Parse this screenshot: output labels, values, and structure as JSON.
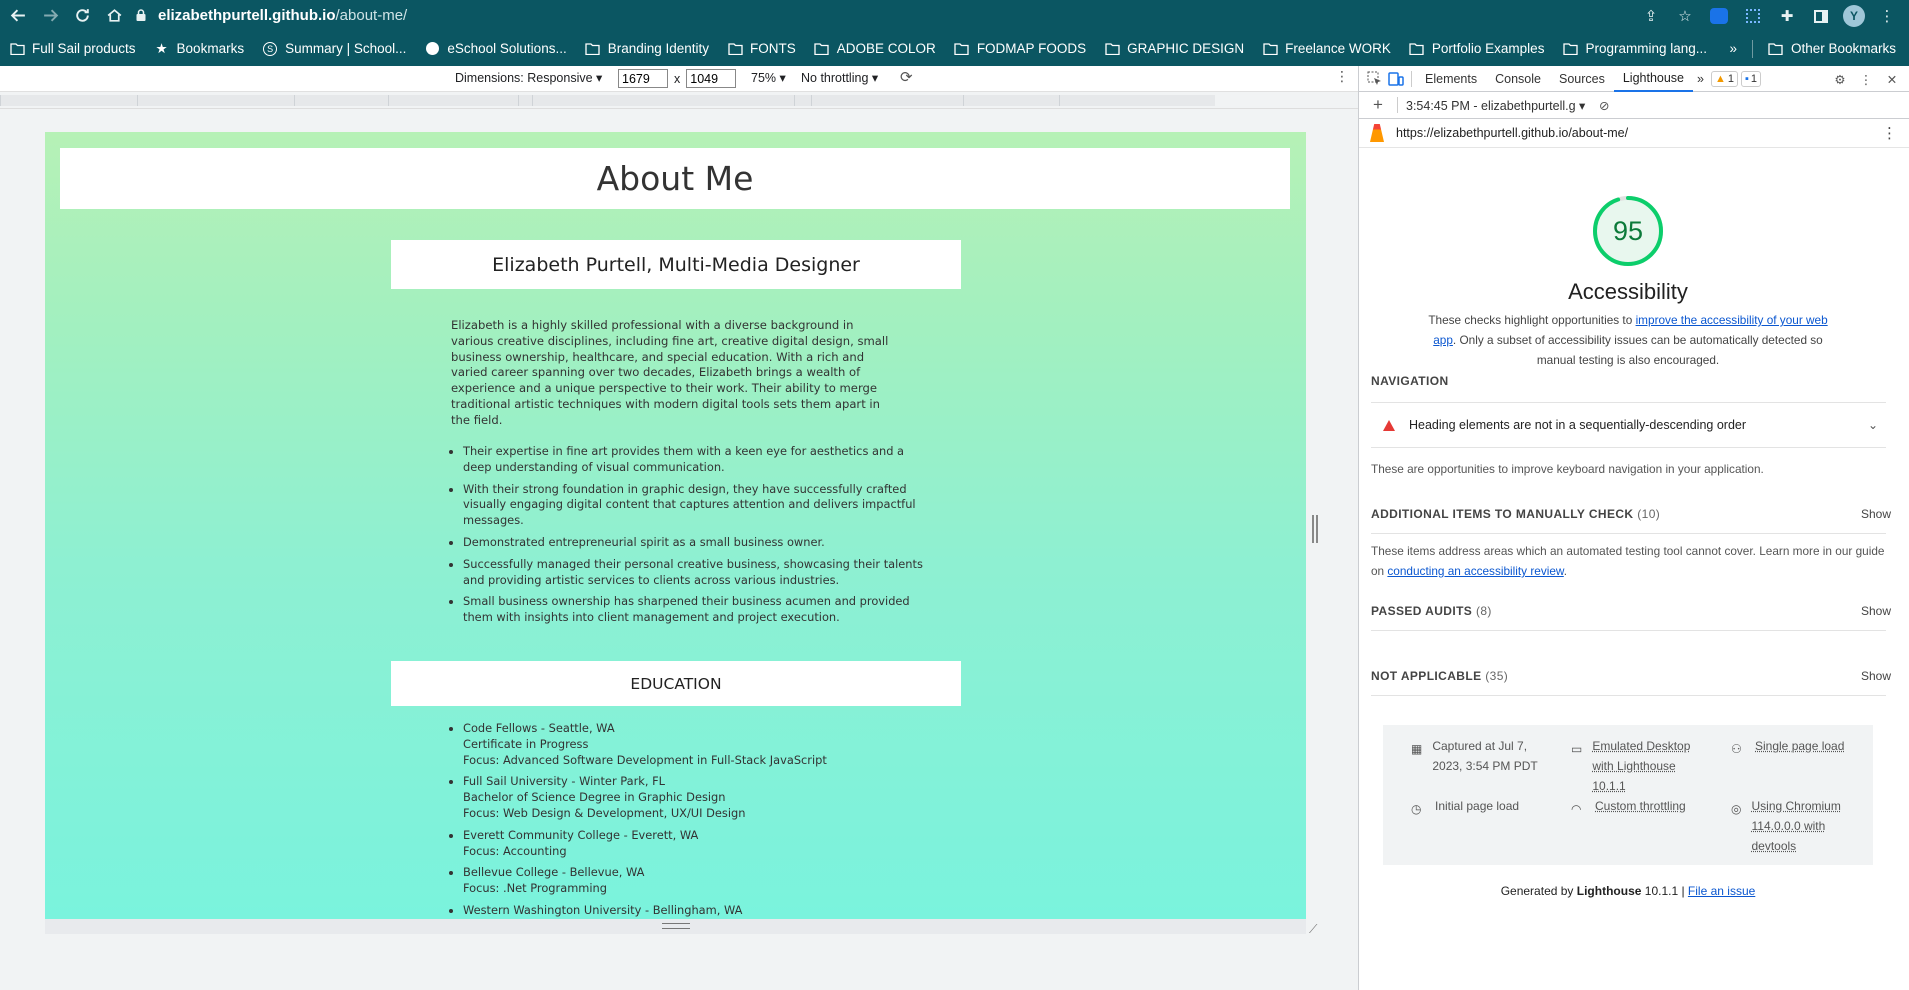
{
  "browser": {
    "url_host": "elizabethpurtell.github.io",
    "url_path": "/about-me/",
    "bookmarks": [
      {
        "label": "Full Sail products",
        "icon": "folder-icon"
      },
      {
        "label": "Bookmarks",
        "icon": "star-icon"
      },
      {
        "label": "Summary | School...",
        "icon": "s-logo-icon"
      },
      {
        "label": "eSchool Solutions...",
        "icon": "globe-icon"
      },
      {
        "label": "Branding Identity",
        "icon": "folder-icon"
      },
      {
        "label": "FONTS",
        "icon": "folder-icon"
      },
      {
        "label": "ADOBE COLOR",
        "icon": "folder-icon"
      },
      {
        "label": "FODMAP FOODS",
        "icon": "folder-icon"
      },
      {
        "label": "GRAPHIC DESIGN",
        "icon": "folder-icon"
      },
      {
        "label": "Freelance WORK",
        "icon": "folder-icon"
      },
      {
        "label": "Portfolio Examples",
        "icon": "folder-icon"
      },
      {
        "label": "Programming lang...",
        "icon": "folder-icon"
      }
    ],
    "overflow": "»",
    "other_bookmarks": "Other Bookmarks"
  },
  "device_toolbar": {
    "dimensions_label": "Dimensions: Responsive ▾",
    "width": "1679",
    "times": "x",
    "height": "1049",
    "zoom": "75% ▾",
    "throttling": "No throttling ▾"
  },
  "page": {
    "title": "About Me",
    "subtitle": "Elizabeth Purtell, Multi-Media Designer",
    "intro": "Elizabeth is a highly skilled professional with a diverse background in various creative disciplines, including fine art, creative digital design, small business ownership, healthcare, and special education. With a rich and varied career spanning over two decades, Elizabeth brings a wealth of experience and a unique perspective to their work. Their ability to merge traditional artistic techniques with modern digital tools sets them apart in the field.",
    "skills": [
      "Their expertise in fine art provides them with a keen eye for aesthetics and a deep understanding of visual communication.",
      "With their strong foundation in graphic design, they have successfully crafted visually engaging digital content that captures attention and delivers impactful messages.",
      "Demonstrated entrepreneurial spirit as a small business owner.",
      "Successfully managed their personal creative business, showcasing their talents and providing artistic services to clients across various industries.",
      "Small business ownership has sharpened their business acumen and provided them with insights into client management and project execution."
    ],
    "education_heading": "EDUCATION",
    "education": [
      {
        "lines": [
          "Code Fellows - Seattle, WA",
          "Certificate in Progress",
          "Focus: Advanced Software Development in Full-Stack JavaScript"
        ]
      },
      {
        "lines": [
          "Full Sail University - Winter Park, FL",
          "Bachelor of Science Degree in Graphic Design",
          "Focus: Web Design & Development, UX/UI Design"
        ]
      },
      {
        "lines": [
          "Everett Community College - Everett, WA",
          "Focus: Accounting"
        ]
      },
      {
        "lines": [
          "Bellevue College - Bellevue, WA",
          "Focus: .Net Programming"
        ]
      },
      {
        "lines": [
          "Western Washington University - Bellingham, WA"
        ]
      }
    ]
  },
  "devtools": {
    "tabs": [
      "Elements",
      "Console",
      "Sources",
      "Lighthouse"
    ],
    "more_tabs": "»",
    "warn_count": "1",
    "info_count": "1",
    "report_selector": "3:54:45 PM - elizabethpurtell.g ▾",
    "report_url": "https://elizabethpurtell.github.io/about-me/",
    "score": "95",
    "score_fraction": 0.95,
    "score_color": "#0cce6b",
    "category": "Accessibility",
    "desc_before": "These checks highlight opportunities to ",
    "desc_link": "improve the accessibility of your web app",
    "desc_after": ". Only a subset of accessibility issues can be automatically detected so manual testing is also encouraged.",
    "nav_group": "NAVIGATION",
    "nav_audit": "Heading elements are not in a sequentially-descending order",
    "nav_desc": "These are opportunities to improve keyboard navigation in your application.",
    "manual_group": "ADDITIONAL ITEMS TO MANUALLY CHECK",
    "manual_count": "(10)",
    "manual_desc_before": "These items address areas which an automated testing tool cannot cover. Learn more in our guide on ",
    "manual_desc_link": "conducting an accessibility review",
    "manual_desc_after": ".",
    "passed_group": "PASSED AUDITS",
    "passed_count": "(8)",
    "na_group": "NOT APPLICABLE",
    "na_count": "(35)",
    "show_label": "Show",
    "meta": {
      "captured": "Captured at Jul 7, 2023, 3:54 PM PDT",
      "emulated": "Emulated Desktop with Lighthouse 10.1.1",
      "single": "Single page load",
      "initial": "Initial page load",
      "throttling": "Custom throttling",
      "chromium": "Using Chromium 114.0.0.0 with devtools"
    },
    "footer_generated": "Generated by ",
    "footer_lighthouse": "Lighthouse",
    "footer_version": " 10.1.1 | ",
    "footer_link": "File an issue"
  }
}
